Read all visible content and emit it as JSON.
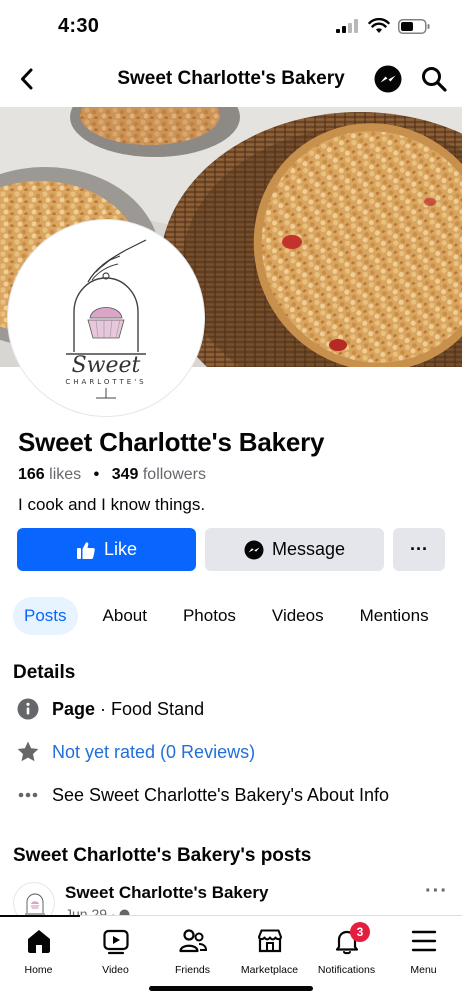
{
  "status_bar": {
    "time": "4:30"
  },
  "nav": {
    "title": "Sweet Charlotte's Bakery",
    "icons": [
      "back-arrow-icon",
      "messenger-icon",
      "search-icon"
    ]
  },
  "page": {
    "name": "Sweet Charlotte's Bakery",
    "likes_count": "166",
    "likes_label": "likes",
    "followers_count": "349",
    "followers_label": "followers",
    "bio": "I cook and I know things.",
    "logo_text": "CHARLOTTE'S"
  },
  "actions": {
    "like_label": "Like",
    "message_label": "Message",
    "more_label": "···"
  },
  "tabs": [
    {
      "label": "Posts",
      "active": true
    },
    {
      "label": "About",
      "active": false
    },
    {
      "label": "Photos",
      "active": false
    },
    {
      "label": "Videos",
      "active": false
    },
    {
      "label": "Mentions",
      "active": false
    }
  ],
  "details": {
    "title": "Details",
    "page_label": "Page",
    "page_category": " · Food Stand",
    "rating": "Not yet rated (0 Reviews)",
    "about_link": "See Sweet Charlotte's Bakery's About Info"
  },
  "posts": {
    "title": "Sweet Charlotte's Bakery's posts",
    "author": "Sweet Charlotte's Bakery",
    "date": "Jun 29 ·"
  },
  "bottom_tabs": [
    {
      "label": "Home",
      "icon": "home-icon"
    },
    {
      "label": "Video",
      "icon": "video-icon"
    },
    {
      "label": "Friends",
      "icon": "friends-icon"
    },
    {
      "label": "Marketplace",
      "icon": "marketplace-icon"
    },
    {
      "label": "Notifications",
      "icon": "bell-icon",
      "badge": "3"
    },
    {
      "label": "Menu",
      "icon": "menu-icon"
    }
  ],
  "colors": {
    "accent": "#0866ff",
    "link": "#216fdb",
    "badge": "#e41e3f",
    "tab_active_bg": "#e7f3ff"
  }
}
